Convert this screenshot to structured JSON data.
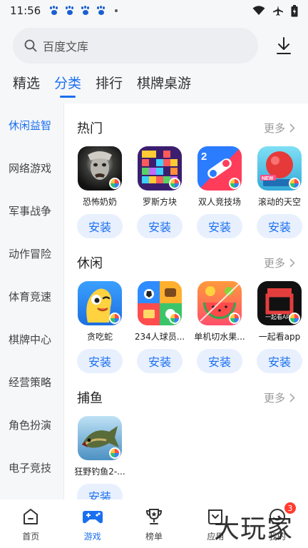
{
  "status": {
    "time": "11:56"
  },
  "search": {
    "placeholder": "百度文库"
  },
  "tabs": [
    {
      "label": "精选"
    },
    {
      "label": "分类"
    },
    {
      "label": "排行"
    },
    {
      "label": "棋牌桌游"
    }
  ],
  "sidebar": {
    "items": [
      {
        "label": "休闲益智"
      },
      {
        "label": "网络游戏"
      },
      {
        "label": "军事战争"
      },
      {
        "label": "动作冒险"
      },
      {
        "label": "体育竞速"
      },
      {
        "label": "棋牌中心"
      },
      {
        "label": "经营策略"
      },
      {
        "label": "角色扮演"
      },
      {
        "label": "电子竞技"
      }
    ]
  },
  "sections": [
    {
      "title": "热门",
      "more": "更多",
      "apps": [
        {
          "name": "恐怖奶奶",
          "install": "安装",
          "icon": "granny-horror-icon"
        },
        {
          "name": "罗斯方块",
          "install": "安装",
          "icon": "tetris-block-icon"
        },
        {
          "name": "双人竞技场",
          "install": "安装",
          "icon": "two-player-arena-icon"
        },
        {
          "name": "滚动的天空",
          "install": "安装",
          "icon": "rolling-sky-icon"
        }
      ]
    },
    {
      "title": "休闲",
      "more": "更多",
      "apps": [
        {
          "name": "贪吃蛇",
          "install": "安装",
          "icon": "snake-icon"
        },
        {
          "name": "234人球员...",
          "install": "安装",
          "icon": "multiplayer-games-icon"
        },
        {
          "name": "单机切水果...",
          "install": "安装",
          "icon": "fruit-slice-icon"
        },
        {
          "name": "一起看app",
          "install": "安装",
          "icon": "watch-together-icon",
          "icon_text": "一起看APP"
        }
      ]
    },
    {
      "title": "捕鱼",
      "more": "更多",
      "apps": [
        {
          "name": "狂野钓鱼2-...",
          "install": "安装",
          "icon": "wild-fishing-icon"
        }
      ]
    }
  ],
  "bottom_nav": [
    {
      "label": "首页",
      "icon": "home-icon"
    },
    {
      "label": "游戏",
      "icon": "gamepad-icon"
    },
    {
      "label": "榜单",
      "icon": "trophy-icon"
    },
    {
      "label": "应用",
      "icon": "apps-icon"
    },
    {
      "label": "我的",
      "icon": "profile-icon",
      "badge": "3"
    }
  ],
  "watermark": "大玩家",
  "colors": {
    "accent": "#1a6ff0",
    "install_bg": "#e8f0fe",
    "badge": "#ff3b30"
  }
}
